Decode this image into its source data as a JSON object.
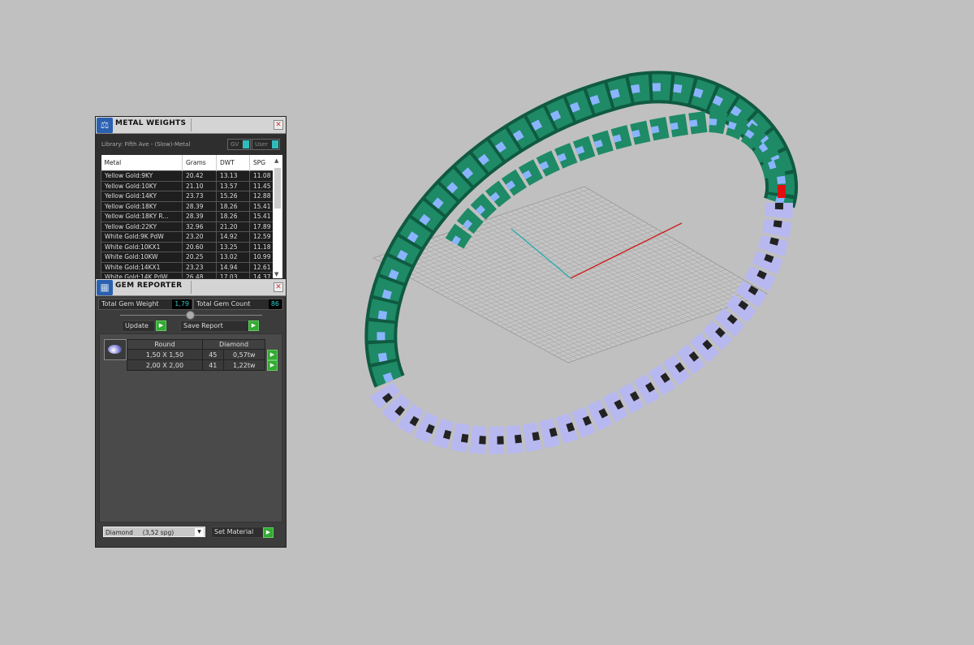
{
  "metal_weights": {
    "title": "METAL WEIGHTS",
    "library": "Library: Fifth Ave - (Slow)-Metal",
    "toggle_gv": "GV",
    "toggle_user": "User",
    "columns": [
      "Metal",
      "Grams",
      "DWT",
      "SPG"
    ],
    "rows": [
      [
        "Yellow Gold:9KY",
        "20.42",
        "13.13",
        "11.08"
      ],
      [
        "Yellow Gold:10KY",
        "21.10",
        "13.57",
        "11.45"
      ],
      [
        "Yellow Gold:14KY",
        "23.73",
        "15.26",
        "12.88"
      ],
      [
        "Yellow Gold:18KY",
        "28.39",
        "18.26",
        "15.41"
      ],
      [
        "Yellow Gold:18KY R...",
        "28.39",
        "18.26",
        "15.41"
      ],
      [
        "Yellow Gold:22KY",
        "32.96",
        "21.20",
        "17.89"
      ],
      [
        "White Gold:9K PdW",
        "23.20",
        "14.92",
        "12.59"
      ],
      [
        "White Gold:10KX1",
        "20.60",
        "13.25",
        "11.18"
      ],
      [
        "White Gold:10KW",
        "20.25",
        "13.02",
        "10.99"
      ],
      [
        "White Gold:14KX1",
        "23.23",
        "14.94",
        "12.61"
      ],
      [
        "White Gold:14K PdW",
        "26.48",
        "17.03",
        "14.37"
      ]
    ]
  },
  "gem_reporter": {
    "title": "GEM REPORTER",
    "total_weight_label": "Total Gem Weight",
    "total_weight": "1,79",
    "total_count_label": "Total Gem Count",
    "total_count": "86",
    "update": "Update",
    "save_report": "Save Report",
    "shape": "Round",
    "material": "Diamond",
    "rows": [
      [
        "1,50 X 1,50",
        "45",
        "0,57tw"
      ],
      [
        "2,00 X 2,00",
        "41",
        "1,22tw"
      ]
    ],
    "material_select": "Diamond     (3,52 spg)",
    "set_material": "Set Material"
  },
  "colors": {
    "viewport": "#c0c0c0",
    "metal": "#1e7a5a",
    "stones": "#8ab4ff",
    "shank": "#b8b8f0",
    "x_axis": "#cc2222",
    "y_axis": "#22aaaa"
  }
}
